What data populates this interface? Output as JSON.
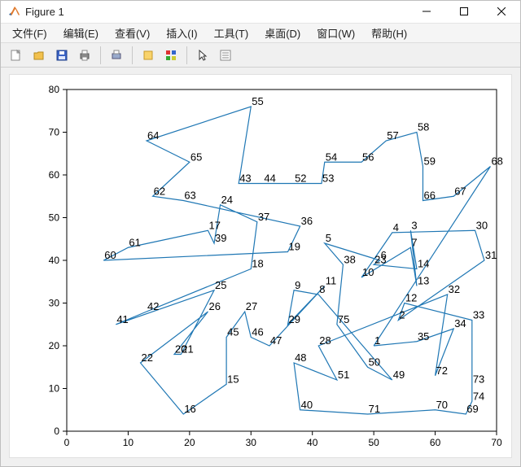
{
  "window": {
    "title": "Figure 1"
  },
  "menu": {
    "file": "文件(F)",
    "edit": "编辑(E)",
    "view": "查看(V)",
    "insert": "插入(I)",
    "tools": "工具(T)",
    "desktop": "桌面(D)",
    "window": "窗口(W)",
    "help": "帮助(H)"
  },
  "toolbar": {
    "new": "New Figure",
    "open": "Open",
    "save": "Save",
    "print": "Print",
    "print2": "Print Preview",
    "link": "Link",
    "palette": "Color",
    "cursor": "Pointer",
    "list": "List"
  },
  "chart_data": {
    "type": "scatter",
    "title": "",
    "xlabel": "",
    "ylabel": "",
    "xlim": [
      0,
      70
    ],
    "ylim": [
      0,
      80
    ],
    "xticks": [
      0,
      10,
      20,
      30,
      40,
      50,
      60,
      70
    ],
    "yticks": [
      0,
      10,
      20,
      30,
      40,
      50,
      60,
      70,
      80
    ],
    "points": [
      {
        "id": 1,
        "x": 50,
        "y": 20
      },
      {
        "id": 2,
        "x": 54,
        "y": 26
      },
      {
        "id": 3,
        "x": 56,
        "y": 47
      },
      {
        "id": 4,
        "x": 53,
        "y": 46.5
      },
      {
        "id": 5,
        "x": 42,
        "y": 44
      },
      {
        "id": 6,
        "x": 51,
        "y": 40
      },
      {
        "id": 7,
        "x": 56,
        "y": 43
      },
      {
        "id": 8,
        "x": 41,
        "y": 32
      },
      {
        "id": 9,
        "x": 37,
        "y": 33
      },
      {
        "id": 10,
        "x": 48,
        "y": 36
      },
      {
        "id": 11,
        "x": 42,
        "y": 34
      },
      {
        "id": 12,
        "x": 55,
        "y": 30
      },
      {
        "id": 13,
        "x": 57,
        "y": 34
      },
      {
        "id": 14,
        "x": 57,
        "y": 38
      },
      {
        "id": 15,
        "x": 26,
        "y": 11
      },
      {
        "id": 16,
        "x": 19,
        "y": 4
      },
      {
        "id": 17,
        "x": 23,
        "y": 47
      },
      {
        "id": 18,
        "x": 30,
        "y": 38
      },
      {
        "id": 19,
        "x": 36,
        "y": 42
      },
      {
        "id": 20,
        "x": 17.5,
        "y": 18
      },
      {
        "id": 21,
        "x": 18.6,
        "y": 18
      },
      {
        "id": 22,
        "x": 12,
        "y": 16
      },
      {
        "id": 23,
        "x": 50,
        "y": 39
      },
      {
        "id": 24,
        "x": 25,
        "y": 53
      },
      {
        "id": 25,
        "x": 24,
        "y": 33
      },
      {
        "id": 26,
        "x": 23,
        "y": 28
      },
      {
        "id": 27,
        "x": 29,
        "y": 28
      },
      {
        "id": 28,
        "x": 41,
        "y": 20
      },
      {
        "id": 29,
        "x": 36,
        "y": 25
      },
      {
        "id": 30,
        "x": 66.5,
        "y": 47
      },
      {
        "id": 31,
        "x": 68,
        "y": 40
      },
      {
        "id": 32,
        "x": 62,
        "y": 32
      },
      {
        "id": 33,
        "x": 66,
        "y": 26
      },
      {
        "id": 34,
        "x": 63,
        "y": 24
      },
      {
        "id": 35,
        "x": 57,
        "y": 21
      },
      {
        "id": 36,
        "x": 38,
        "y": 48
      },
      {
        "id": 37,
        "x": 31,
        "y": 49
      },
      {
        "id": 38,
        "x": 45,
        "y": 39
      },
      {
        "id": 39,
        "x": 24,
        "y": 44
      },
      {
        "id": 40,
        "x": 38,
        "y": 5
      },
      {
        "id": 41,
        "x": 8,
        "y": 25
      },
      {
        "id": 42,
        "x": 13,
        "y": 28
      },
      {
        "id": 43,
        "x": 28,
        "y": 58
      },
      {
        "id": 44,
        "x": 32,
        "y": 58
      },
      {
        "id": 45,
        "x": 26,
        "y": 22
      },
      {
        "id": 46,
        "x": 30,
        "y": 22
      },
      {
        "id": 47,
        "x": 33,
        "y": 20
      },
      {
        "id": 48,
        "x": 37,
        "y": 16
      },
      {
        "id": 49,
        "x": 53,
        "y": 12
      },
      {
        "id": 50,
        "x": 49,
        "y": 15
      },
      {
        "id": 51,
        "x": 44,
        "y": 12
      },
      {
        "id": 52,
        "x": 37,
        "y": 58
      },
      {
        "id": 53,
        "x": 41.5,
        "y": 58
      },
      {
        "id": 54,
        "x": 42,
        "y": 63
      },
      {
        "id": 55,
        "x": 30,
        "y": 76
      },
      {
        "id": 56,
        "x": 48,
        "y": 63
      },
      {
        "id": 57,
        "x": 52,
        "y": 68
      },
      {
        "id": 58,
        "x": 57,
        "y": 70
      },
      {
        "id": 59,
        "x": 58,
        "y": 62
      },
      {
        "id": 60,
        "x": 6,
        "y": 40
      },
      {
        "id": 61,
        "x": 10,
        "y": 43
      },
      {
        "id": 62,
        "x": 14,
        "y": 55
      },
      {
        "id": 63,
        "x": 19,
        "y": 54
      },
      {
        "id": 64,
        "x": 13,
        "y": 68
      },
      {
        "id": 65,
        "x": 20,
        "y": 63
      },
      {
        "id": 66,
        "x": 58,
        "y": 54
      },
      {
        "id": 67,
        "x": 63,
        "y": 55
      },
      {
        "id": 68,
        "x": 69,
        "y": 62
      },
      {
        "id": 69,
        "x": 65,
        "y": 4
      },
      {
        "id": 70,
        "x": 60,
        "y": 5
      },
      {
        "id": 71,
        "x": 49,
        "y": 4
      },
      {
        "id": 72,
        "x": 60,
        "y": 13
      },
      {
        "id": 73,
        "x": 66,
        "y": 11
      },
      {
        "id": 74,
        "x": 66,
        "y": 7
      },
      {
        "id": 75,
        "x": 44,
        "y": 25
      }
    ],
    "path_order": [
      1,
      35,
      34,
      72,
      32,
      28,
      51,
      48,
      40,
      71,
      70,
      69,
      74,
      73,
      33,
      12,
      2,
      31,
      30,
      4,
      10,
      7,
      13,
      3,
      14,
      23,
      6,
      5,
      38,
      75,
      50,
      49,
      8,
      9,
      29,
      11,
      47,
      46,
      27,
      45,
      15,
      16,
      22,
      26,
      20,
      21,
      25,
      41,
      42,
      18,
      37,
      24,
      39,
      17,
      61,
      60,
      19,
      36,
      63,
      62,
      65,
      64,
      55,
      43,
      44,
      52,
      53,
      54,
      56,
      57,
      58,
      59,
      66,
      67,
      68,
      1
    ]
  }
}
